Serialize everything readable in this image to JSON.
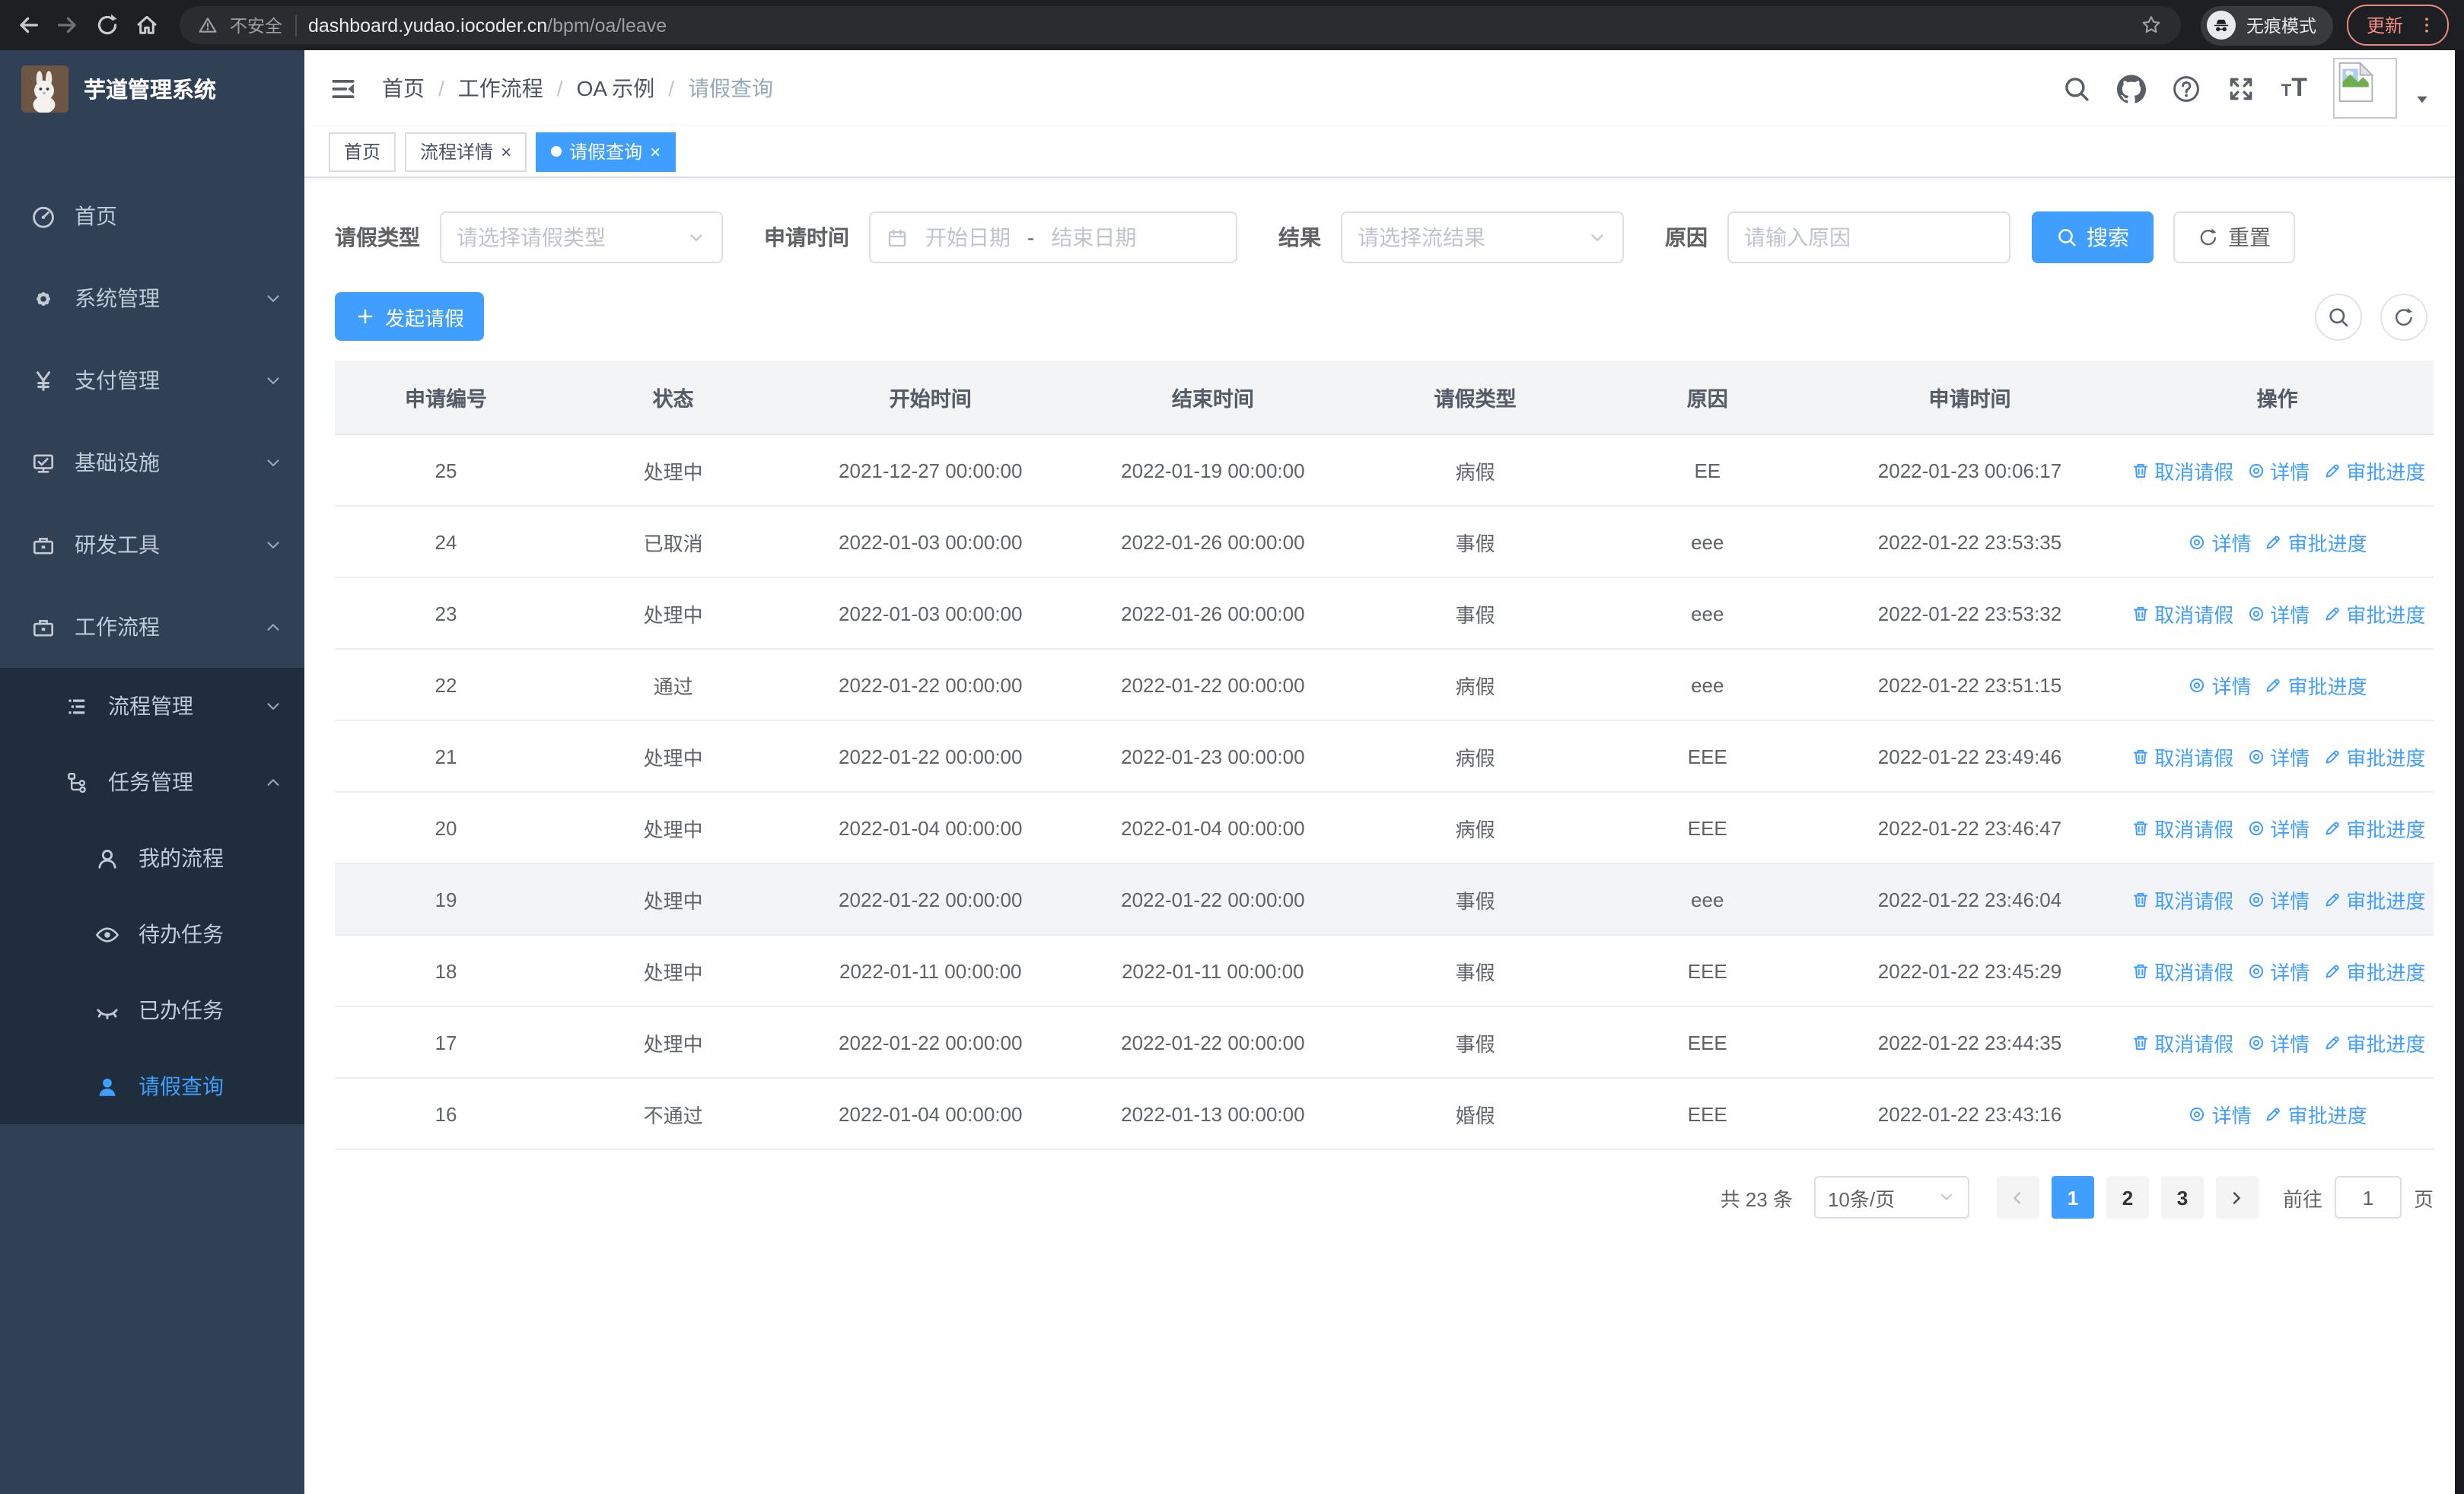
{
  "browser": {
    "security_label": "不安全",
    "url_domain": "dashboard.yudao.iocoder.cn",
    "url_path": "/bpm/oa/leave",
    "incognito_label": "无痕模式",
    "update_label": "更新"
  },
  "sidebar": {
    "title": "芋道管理系统",
    "items": [
      {
        "id": "home",
        "label": "首页",
        "icon": "dashboard-icon",
        "level": 1,
        "chevron": null,
        "active": false,
        "sub": false
      },
      {
        "id": "system",
        "label": "系统管理",
        "icon": "gear-icon",
        "level": 1,
        "chevron": "down",
        "active": false,
        "sub": false
      },
      {
        "id": "payment",
        "label": "支付管理",
        "icon": "yen-icon",
        "level": 1,
        "chevron": "down",
        "active": false,
        "sub": false
      },
      {
        "id": "infrastructure",
        "label": "基础设施",
        "icon": "monitor-icon",
        "level": 1,
        "chevron": "down",
        "active": false,
        "sub": false
      },
      {
        "id": "devtools",
        "label": "研发工具",
        "icon": "briefcase-icon",
        "level": 1,
        "chevron": "down",
        "active": false,
        "sub": false
      },
      {
        "id": "workflow",
        "label": "工作流程",
        "icon": "briefcase-icon",
        "level": 1,
        "chevron": "up",
        "active": false,
        "sub": false
      },
      {
        "id": "process-mgmt",
        "label": "流程管理",
        "icon": "list-icon",
        "level": 2,
        "chevron": "down",
        "active": false,
        "sub": true
      },
      {
        "id": "task-mgmt",
        "label": "任务管理",
        "icon": "tree-icon",
        "level": 2,
        "chevron": "up",
        "active": false,
        "sub": true
      },
      {
        "id": "my-process",
        "label": "我的流程",
        "icon": "user-icon",
        "level": 3,
        "chevron": null,
        "active": false,
        "sub": true
      },
      {
        "id": "todo-task",
        "label": "待办任务",
        "icon": "eye-open-icon",
        "level": 3,
        "chevron": null,
        "active": false,
        "sub": true
      },
      {
        "id": "done-task",
        "label": "已办任务",
        "icon": "eye-closed-icon",
        "level": 3,
        "chevron": null,
        "active": false,
        "sub": true
      },
      {
        "id": "leave-query",
        "label": "请假查询",
        "icon": "user-solid-icon",
        "level": 3,
        "chevron": null,
        "active": true,
        "sub": true
      }
    ]
  },
  "breadcrumb": {
    "items": [
      "首页",
      "工作流程",
      "OA 示例",
      "请假查询"
    ],
    "separator": "/"
  },
  "tabs": [
    {
      "label": "首页",
      "closable": false,
      "active": false
    },
    {
      "label": "流程详情",
      "closable": true,
      "active": false
    },
    {
      "label": "请假查询",
      "closable": true,
      "active": true
    }
  ],
  "filters": {
    "type_label": "请假类型",
    "type_placeholder": "请选择请假类型",
    "time_label": "申请时间",
    "time_start_placeholder": "开始日期",
    "time_separator": "-",
    "time_end_placeholder": "结束日期",
    "result_label": "结果",
    "result_placeholder": "请选择流结果",
    "reason_label": "原因",
    "reason_placeholder": "请输入原因",
    "search_label": "搜索",
    "reset_label": "重置"
  },
  "toolbar": {
    "create_label": "发起请假"
  },
  "table": {
    "headers": [
      "申请编号",
      "状态",
      "开始时间",
      "结束时间",
      "请假类型",
      "原因",
      "申请时间",
      "操作"
    ],
    "action_labels": {
      "cancel": "取消请假",
      "detail": "详情",
      "progress": "审批进度"
    },
    "rows": [
      {
        "id": "25",
        "status": "处理中",
        "start": "2021-12-27 00:00:00",
        "end": "2022-01-19 00:00:00",
        "type": "病假",
        "reason": "EE",
        "apply_time": "2022-01-23 00:06:17",
        "actions": [
          "cancel",
          "detail",
          "progress"
        ],
        "highlight": false
      },
      {
        "id": "24",
        "status": "已取消",
        "start": "2022-01-03 00:00:00",
        "end": "2022-01-26 00:00:00",
        "type": "事假",
        "reason": "eee",
        "apply_time": "2022-01-22 23:53:35",
        "actions": [
          "detail",
          "progress"
        ],
        "highlight": false
      },
      {
        "id": "23",
        "status": "处理中",
        "start": "2022-01-03 00:00:00",
        "end": "2022-01-26 00:00:00",
        "type": "事假",
        "reason": "eee",
        "apply_time": "2022-01-22 23:53:32",
        "actions": [
          "cancel",
          "detail",
          "progress"
        ],
        "highlight": false
      },
      {
        "id": "22",
        "status": "通过",
        "start": "2022-01-22 00:00:00",
        "end": "2022-01-22 00:00:00",
        "type": "病假",
        "reason": "eee",
        "apply_time": "2022-01-22 23:51:15",
        "actions": [
          "detail",
          "progress"
        ],
        "highlight": false
      },
      {
        "id": "21",
        "status": "处理中",
        "start": "2022-01-22 00:00:00",
        "end": "2022-01-23 00:00:00",
        "type": "病假",
        "reason": "EEE",
        "apply_time": "2022-01-22 23:49:46",
        "actions": [
          "cancel",
          "detail",
          "progress"
        ],
        "highlight": false
      },
      {
        "id": "20",
        "status": "处理中",
        "start": "2022-01-04 00:00:00",
        "end": "2022-01-04 00:00:00",
        "type": "病假",
        "reason": "EEE",
        "apply_time": "2022-01-22 23:46:47",
        "actions": [
          "cancel",
          "detail",
          "progress"
        ],
        "highlight": false
      },
      {
        "id": "19",
        "status": "处理中",
        "start": "2022-01-22 00:00:00",
        "end": "2022-01-22 00:00:00",
        "type": "事假",
        "reason": "eee",
        "apply_time": "2022-01-22 23:46:04",
        "actions": [
          "cancel",
          "detail",
          "progress"
        ],
        "highlight": true
      },
      {
        "id": "18",
        "status": "处理中",
        "start": "2022-01-11 00:00:00",
        "end": "2022-01-11 00:00:00",
        "type": "事假",
        "reason": "EEE",
        "apply_time": "2022-01-22 23:45:29",
        "actions": [
          "cancel",
          "detail",
          "progress"
        ],
        "highlight": false
      },
      {
        "id": "17",
        "status": "处理中",
        "start": "2022-01-22 00:00:00",
        "end": "2022-01-22 00:00:00",
        "type": "事假",
        "reason": "EEE",
        "apply_time": "2022-01-22 23:44:35",
        "actions": [
          "cancel",
          "detail",
          "progress"
        ],
        "highlight": false
      },
      {
        "id": "16",
        "status": "不通过",
        "start": "2022-01-04 00:00:00",
        "end": "2022-01-13 00:00:00",
        "type": "婚假",
        "reason": "EEE",
        "apply_time": "2022-01-22 23:43:16",
        "actions": [
          "detail",
          "progress"
        ],
        "highlight": false
      }
    ]
  },
  "pagination": {
    "total_label": "共 23 条",
    "page_size_label": "10条/页",
    "pages": [
      "1",
      "2",
      "3"
    ],
    "active_page": "1",
    "goto_label": "前往",
    "goto_value": "1",
    "page_unit_label": "页"
  },
  "colors": {
    "accent": "#409eff",
    "sidebar_bg": "#304156",
    "submenu_bg": "#1f2d3d",
    "update_red": "#f28b82"
  }
}
